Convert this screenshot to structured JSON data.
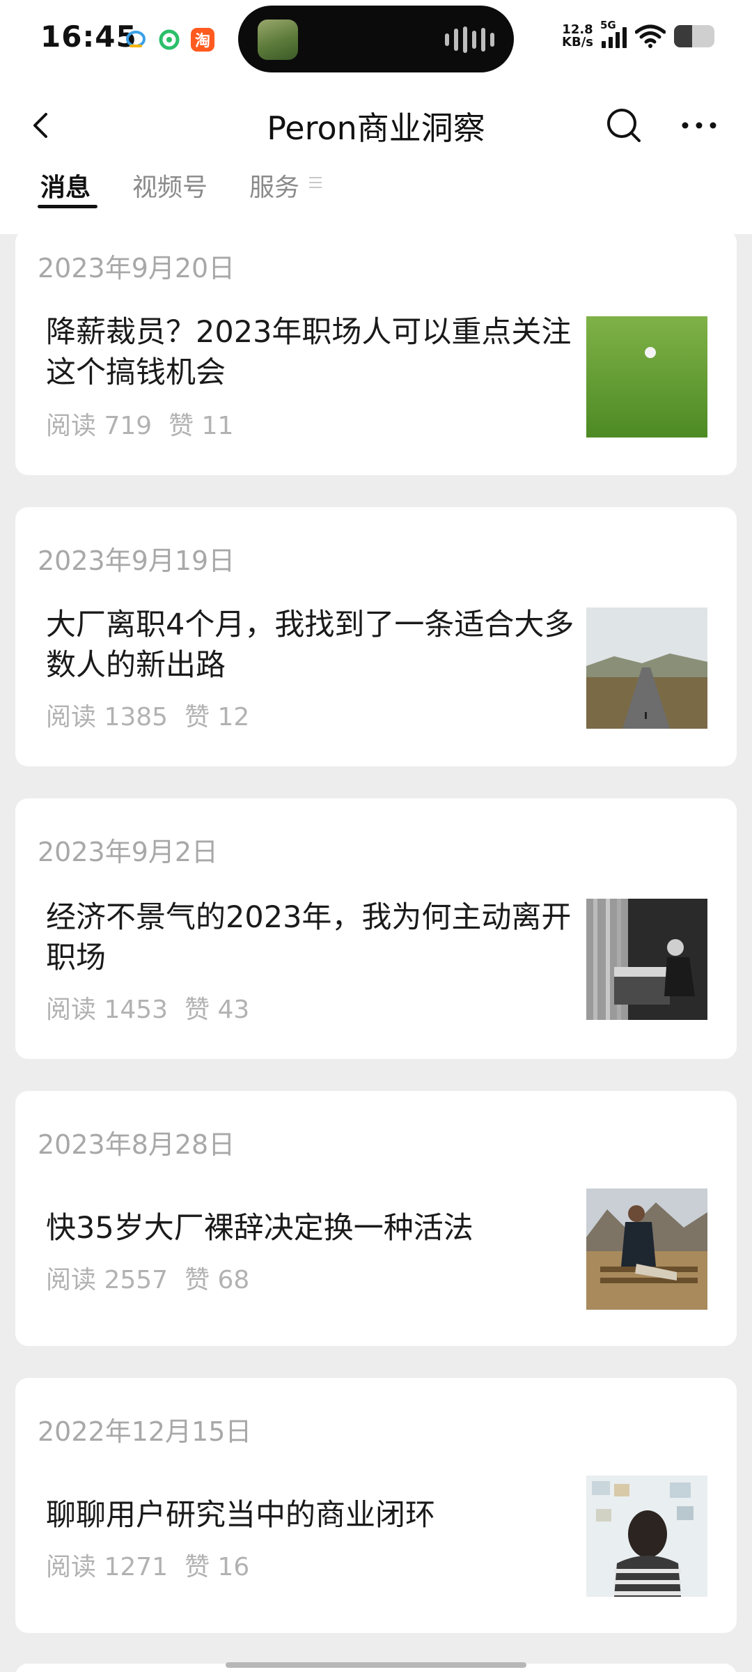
{
  "status_bar": {
    "time": "16:45",
    "app_icons": [
      "qq-icon",
      "wechat-mini-icon",
      "taobao-icon"
    ],
    "taobao_glyph": "淘",
    "network_speed_value": "12.8",
    "network_speed_unit": "KB/s",
    "network_type": "5G",
    "battery_level": 0.45
  },
  "header": {
    "title": "Peron商业洞察",
    "back_icon": "chevron-left-icon",
    "search_icon": "search-icon",
    "more_icon": "more-dots-icon"
  },
  "tabs": [
    {
      "label": "消息",
      "active": true
    },
    {
      "label": "视频号",
      "active": false
    },
    {
      "label": "服务",
      "active": false
    }
  ],
  "articles": [
    {
      "date": "2023年9月20日",
      "title": "降薪裁员？2023年职场人可以重点关注这个搞钱机会",
      "reads": "阅读 719",
      "likes": "赞 11",
      "thumb": "golf-ball-on-grass"
    },
    {
      "date": "2023年9月19日",
      "title": "大厂离职4个月，我找到了一条适合大多数人的新出路",
      "reads": "阅读 1385",
      "likes": "赞 12",
      "thumb": "empty-road-landscape"
    },
    {
      "date": "2023年9月2日",
      "title": "经济不景气的2023年，我为何主动离开职场",
      "reads": "阅读 1453",
      "likes": "赞 43",
      "thumb": "man-at-office-desk-bw"
    },
    {
      "date": "2023年8月28日",
      "title": "快35岁大厂裸辞决定换一种活法",
      "reads": "阅读 2557",
      "likes": "赞 68",
      "thumb": "man-sitting-on-bench-mountains"
    },
    {
      "date": "2022年12月15日",
      "title": "聊聊用户研究当中的商业闭环",
      "reads": "阅读 1271",
      "likes": "赞 16",
      "thumb": "man-facing-wall-of-notes"
    }
  ],
  "colors": {
    "background": "#ededed",
    "card": "#ffffff",
    "date_text": "#a8a8a8",
    "meta_text": "#b2b2b2",
    "active_tab": "#111111",
    "inactive_tab": "#8a8a8a"
  }
}
